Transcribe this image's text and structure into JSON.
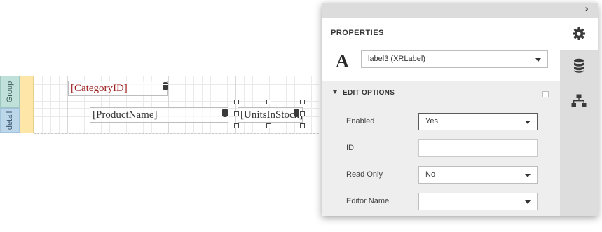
{
  "designer": {
    "bands": [
      {
        "name": "Group"
      },
      {
        "name": "detail"
      }
    ],
    "labels": {
      "category": "[CategoryID]",
      "product": "[ProductName]",
      "units": "[UnitsInStock]"
    }
  },
  "panel": {
    "title": "PROPERTIES",
    "type_glyph": "A",
    "component_select": "label3 (XRLabel)",
    "section": {
      "title": "EDIT OPTIONS",
      "rows": [
        {
          "label": "Enabled",
          "value": "Yes",
          "kind": "select"
        },
        {
          "label": "ID",
          "value": "",
          "kind": "text"
        },
        {
          "label": "Read Only",
          "value": "No",
          "kind": "select"
        },
        {
          "label": "Editor Name",
          "value": "",
          "kind": "select"
        }
      ]
    },
    "side_tabs": [
      {
        "icon": "gear-icon",
        "active": true
      },
      {
        "icon": "database-icon",
        "active": false
      },
      {
        "icon": "hierarchy-icon",
        "active": false
      }
    ]
  }
}
